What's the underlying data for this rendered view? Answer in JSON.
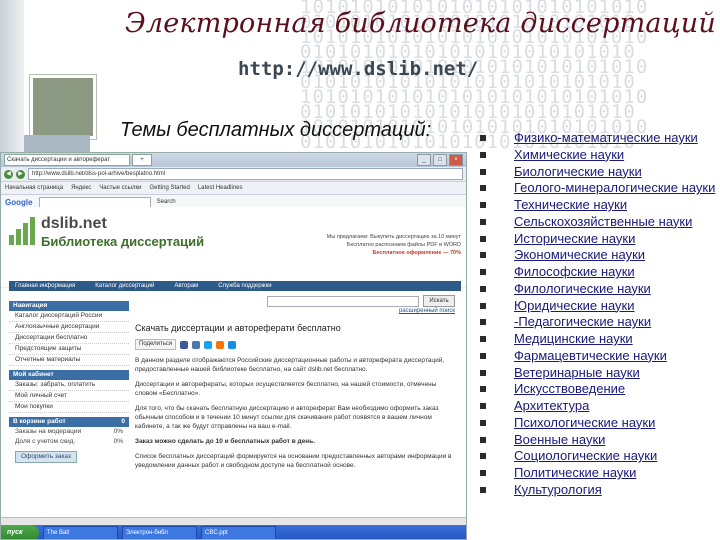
{
  "slide": {
    "title": "Электронная библиотека диссертаций",
    "url": "http://www.dslib.net/",
    "subtitle": "Темы бесплатных диссертаций:",
    "background_pattern": "1010101010101010101010101010"
  },
  "topics": [
    "Физико-математические науки",
    "Химические науки",
    "Биологические науки",
    "Геолого-минералогические науки",
    "Технические науки",
    "Сельскохозяйственные науки",
    "Исторические науки",
    "Экономические науки",
    "Философские науки",
    "Филологические науки",
    "Юридические науки",
    "-Педагогические науки",
    "Медицинские науки",
    "Фармацевтические науки",
    "Ветеринарные науки",
    "Искусствоведение",
    "Архитектура",
    "Психологические науки",
    "Военные науки",
    "Социологические науки",
    "Политические науки",
    "Культурология"
  ],
  "browser": {
    "tab_label": "Скачать диссертации и автореферат",
    "tab_new": "+",
    "address": "http://www.dslib.net/diss-pol-arhive/besplatno.html",
    "bookmarks": [
      "Начальная страница",
      "Яндекс",
      "Частые ссылки",
      "Getting Started",
      "Latest Headlines"
    ],
    "google_label": "Google",
    "google_search": "Search",
    "site": {
      "logo_name": "dslib.net",
      "logo_sub": "Библиотека диссертаций",
      "promo_line1": "Мы предлагаем: Выкупить диссертацию за 10 минут",
      "promo_line2": "Бесплатно распознаем файлы PDF в WORD",
      "promo_line3": "Бесплатное оформление — 70%",
      "nav": [
        "Главная информация",
        "Каталог диссертаций",
        "Авторам",
        "Служба поддержки"
      ],
      "sidebar": {
        "nav_head": "Навигация",
        "nav_links": [
          "Каталог диссертаций России",
          "Англоязычные диссертации",
          "Диссертации бесплатно",
          "Предстоящие защиты",
          "Отчетные материалы"
        ],
        "cabinet_head": "Мой кабинет",
        "cabinet_links": [
          "Заказы: забрать, оплатить",
          "Мой личный счет",
          "Мои покупки"
        ],
        "work_head": "В корзине работ",
        "work_head_count": "0",
        "table": [
          {
            "label": "Заказы на модерации",
            "value": "0%"
          },
          {
            "label": "Доля с учетом скид.",
            "value": "0%"
          }
        ],
        "checkout": "Оформить заказ"
      },
      "content": {
        "search_button": "Искать",
        "advanced_search": "расширенный поиск",
        "heading": "Скачать диссертации и автореферати бесплатно",
        "share_label": "Поделиться",
        "p1": "В данном разделе отображаются Российские диссертационные работы и автореферата диссертаций, предоставленные нашей библиотеке бесплатно, на сайт dslib.net бесплатно.",
        "p2": "Диссертации и авторефераты, которых осуществляется бесплатно, на нашей стоимости, отмечены словом «Бесплатно».",
        "p3": "Для того, что бы скачать бесплатную диссертацию и автореферат Вам необходимо оформить заказ обычным способом и в течении 10 минут ссылки для скачивания работ появятся в вашем личном кабинете, а так же будут отправлены на ваш e-mail.",
        "p4": "Заказ можно сделать до 10 и бесплатных работ в день.",
        "p5": "Список бесплатных диссертаций формируется на основании предоставленных авторами информации в уведомлении данных работ и свободном доступе на бесплатной основе."
      }
    },
    "taskbar": {
      "start": "пуск",
      "tasks": [
        "The Bat!",
        "Электрон-библ",
        "CBC.ppt"
      ]
    }
  }
}
